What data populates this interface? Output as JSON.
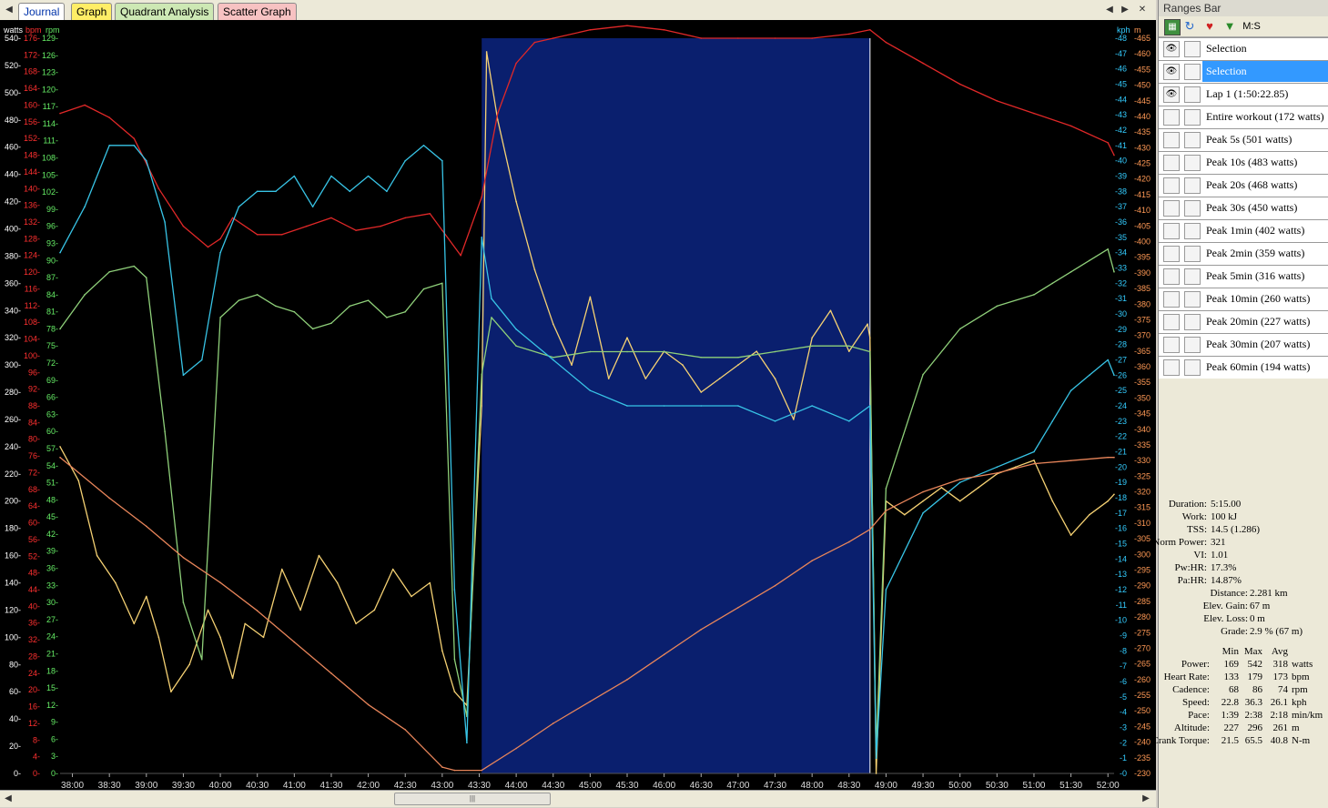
{
  "tabs": [
    {
      "label": "Journal",
      "color": "#ffffff",
      "active": true
    },
    {
      "label": "Graph",
      "color": "#ffee66"
    },
    {
      "label": "Quadrant Analysis",
      "color": "#cde8b4"
    },
    {
      "label": "Scatter Graph",
      "color": "#f7c2c2"
    }
  ],
  "ranges_bar": {
    "title": "Ranges Bar",
    "mode_label": "M:S",
    "items": [
      {
        "label": "Selection",
        "eye": true,
        "selected": false
      },
      {
        "label": "Selection",
        "eye": true,
        "selected": true
      },
      {
        "label": "Lap 1 (1:50:22.85)",
        "eye": true,
        "selected": false
      },
      {
        "label": "Entire workout (172 watts)",
        "eye": false
      },
      {
        "label": "Peak 5s (501 watts)",
        "eye": false
      },
      {
        "label": "Peak 10s (483 watts)",
        "eye": false
      },
      {
        "label": "Peak 20s (468 watts)",
        "eye": false
      },
      {
        "label": "Peak 30s (450 watts)",
        "eye": false
      },
      {
        "label": "Peak 1min (402 watts)",
        "eye": false
      },
      {
        "label": "Peak 2min (359 watts)",
        "eye": false
      },
      {
        "label": "Peak 5min (316 watts)",
        "eye": false
      },
      {
        "label": "Peak 10min (260 watts)",
        "eye": false
      },
      {
        "label": "Peak 20min (227 watts)",
        "eye": false
      },
      {
        "label": "Peak 30min (207 watts)",
        "eye": false
      },
      {
        "label": "Peak 60min (194 watts)",
        "eye": false
      }
    ]
  },
  "summary": [
    {
      "k": "Duration:",
      "v": "5:15.00"
    },
    {
      "k": "Work:",
      "v": "100 kJ"
    },
    {
      "k": "TSS:",
      "v": "14.5 (1.286)"
    },
    {
      "k": "Norm Power:",
      "v": "321"
    },
    {
      "k": "VI:",
      "v": "1.01"
    },
    {
      "k": "Pw:HR:",
      "v": "17.3%"
    },
    {
      "k": "Pa:HR:",
      "v": "14.87%"
    },
    {
      "k": "Distance:",
      "v": "2.281 km"
    },
    {
      "k": "Elev. Gain:",
      "v": "67 m"
    },
    {
      "k": "Elev. Loss:",
      "v": "0 m"
    },
    {
      "k": "Grade:",
      "v": "2.9 % (67 m)"
    }
  ],
  "stats": {
    "header": {
      "min": "Min",
      "max": "Max",
      "avg": "Avg"
    },
    "rows": [
      {
        "k": "Power:",
        "min": "169",
        "max": "542",
        "avg": "318",
        "unit": "watts"
      },
      {
        "k": "Heart Rate:",
        "min": "133",
        "max": "179",
        "avg": "173",
        "unit": "bpm"
      },
      {
        "k": "Cadence:",
        "min": "68",
        "max": "86",
        "avg": "74",
        "unit": "rpm"
      },
      {
        "k": "Speed:",
        "min": "22.8",
        "max": "36.3",
        "avg": "26.1",
        "unit": "kph"
      },
      {
        "k": "Pace:",
        "min": "1:39",
        "max": "2:38",
        "avg": "2:18",
        "unit": "min/km"
      },
      {
        "k": "Altitude:",
        "min": "227",
        "max": "296",
        "avg": "261",
        "unit": "m"
      },
      {
        "k": "Crank Torque:",
        "min": "21.5",
        "max": "65.5",
        "avg": "40.8",
        "unit": "N-m"
      }
    ]
  },
  "chart_data": {
    "type": "line",
    "x_ticks": [
      "38:00",
      "38:30",
      "39:00",
      "39:30",
      "40:00",
      "40:30",
      "41:00",
      "41:30",
      "42:00",
      "42:30",
      "43:00",
      "43:30",
      "44:00",
      "44:30",
      "45:00",
      "45:30",
      "46:00",
      "46:30",
      "47:00",
      "47:30",
      "48:00",
      "48:30",
      "49:00",
      "49:30",
      "50:00",
      "50:30",
      "51:00",
      "51:30",
      "52:00"
    ],
    "x_range": [
      "37:50",
      "52:05"
    ],
    "selection": [
      "43:32",
      "48:47"
    ],
    "axes": {
      "watts": {
        "label": "watts",
        "color": "#ffffff",
        "min": 0,
        "max": 540,
        "step": 20
      },
      "bpm": {
        "label": "bpm",
        "color": "#ff3030",
        "min": 0,
        "max": 176,
        "step": 4
      },
      "rpm": {
        "label": "rpm",
        "color": "#66ee66",
        "min": 0,
        "max": 129,
        "step": 3
      },
      "kph": {
        "label": "kph",
        "color": "#33ccff",
        "min": 0,
        "max": 48,
        "step": 1
      },
      "m": {
        "label": "m",
        "color": "#ff9955",
        "min": 230,
        "max": 465,
        "step": 5
      }
    },
    "series": [
      {
        "name": "Power",
        "axis": "watts",
        "color": "#f5d173",
        "t": [
          "37:50",
          "38:05",
          "38:20",
          "38:35",
          "38:50",
          "39:00",
          "39:10",
          "39:20",
          "39:35",
          "39:50",
          "40:00",
          "40:10",
          "40:20",
          "40:35",
          "40:50",
          "41:05",
          "41:20",
          "41:35",
          "41:50",
          "42:05",
          "42:20",
          "42:35",
          "42:50",
          "43:00",
          "43:10",
          "43:20",
          "43:32",
          "43:36",
          "43:45",
          "44:00",
          "44:15",
          "44:30",
          "44:45",
          "45:00",
          "45:15",
          "45:30",
          "45:45",
          "46:00",
          "46:15",
          "46:30",
          "46:45",
          "47:00",
          "47:15",
          "47:30",
          "47:45",
          "48:00",
          "48:15",
          "48:30",
          "48:45",
          "48:47",
          "48:52",
          "49:00",
          "49:15",
          "49:30",
          "49:45",
          "50:00",
          "50:15",
          "50:30",
          "50:45",
          "51:00",
          "51:15",
          "51:30",
          "51:45",
          "52:00",
          "52:05"
        ],
        "v": [
          240,
          215,
          160,
          140,
          110,
          130,
          100,
          60,
          80,
          120,
          100,
          70,
          110,
          100,
          150,
          120,
          160,
          140,
          110,
          120,
          150,
          130,
          140,
          90,
          60,
          50,
          270,
          530,
          480,
          420,
          370,
          330,
          300,
          350,
          290,
          320,
          290,
          310,
          300,
          280,
          290,
          300,
          310,
          290,
          260,
          320,
          340,
          310,
          330,
          320,
          0,
          200,
          190,
          200,
          210,
          200,
          210,
          220,
          225,
          230,
          200,
          175,
          190,
          200,
          205
        ]
      },
      {
        "name": "Heart Rate",
        "axis": "bpm",
        "color": "#e02828",
        "t": [
          "37:50",
          "38:10",
          "38:30",
          "38:50",
          "39:10",
          "39:30",
          "39:50",
          "40:00",
          "40:10",
          "40:30",
          "40:50",
          "41:10",
          "41:30",
          "41:50",
          "42:10",
          "42:30",
          "42:50",
          "43:00",
          "43:15",
          "43:32",
          "43:45",
          "44:00",
          "44:15",
          "44:30",
          "45:00",
          "45:30",
          "46:00",
          "46:30",
          "47:00",
          "47:30",
          "48:00",
          "48:30",
          "48:47",
          "49:00",
          "49:30",
          "50:00",
          "50:30",
          "51:00",
          "51:30",
          "52:00",
          "52:05"
        ],
        "v": [
          158,
          160,
          157,
          152,
          140,
          131,
          126,
          128,
          133,
          129,
          129,
          131,
          133,
          130,
          131,
          133,
          134,
          130,
          124,
          138,
          158,
          170,
          175,
          176,
          178,
          179,
          178,
          176,
          176,
          176,
          176,
          177,
          178,
          175,
          170,
          165,
          161,
          158,
          155,
          151,
          148
        ]
      },
      {
        "name": "Cadence",
        "axis": "rpm",
        "color": "#8fd07a",
        "t": [
          "37:50",
          "38:10",
          "38:30",
          "38:50",
          "39:00",
          "39:15",
          "39:30",
          "39:45",
          "40:00",
          "40:15",
          "40:30",
          "40:45",
          "41:00",
          "41:15",
          "41:30",
          "41:45",
          "42:00",
          "42:15",
          "42:30",
          "42:45",
          "43:00",
          "43:10",
          "43:20",
          "43:32",
          "43:40",
          "44:00",
          "44:30",
          "45:00",
          "45:30",
          "46:00",
          "46:30",
          "47:00",
          "47:30",
          "48:00",
          "48:30",
          "48:47",
          "48:52",
          "49:00",
          "49:30",
          "50:00",
          "50:30",
          "51:00",
          "51:15",
          "51:30",
          "51:45",
          "52:00",
          "52:05"
        ],
        "v": [
          78,
          84,
          88,
          89,
          87,
          60,
          30,
          20,
          80,
          83,
          84,
          82,
          81,
          78,
          79,
          82,
          83,
          80,
          81,
          85,
          86,
          20,
          10,
          70,
          80,
          75,
          73,
          74,
          74,
          74,
          73,
          73,
          74,
          75,
          75,
          74,
          4,
          50,
          70,
          78,
          82,
          84,
          86,
          88,
          90,
          92,
          88
        ]
      },
      {
        "name": "Speed",
        "axis": "kph",
        "color": "#38c4e6",
        "t": [
          "37:50",
          "38:10",
          "38:30",
          "38:50",
          "39:00",
          "39:15",
          "39:30",
          "39:45",
          "40:00",
          "40:15",
          "40:30",
          "40:45",
          "41:00",
          "41:15",
          "41:30",
          "41:45",
          "42:00",
          "42:15",
          "42:30",
          "42:45",
          "43:00",
          "43:10",
          "43:20",
          "43:32",
          "43:40",
          "44:00",
          "44:30",
          "45:00",
          "45:30",
          "46:00",
          "46:30",
          "47:00",
          "47:30",
          "48:00",
          "48:30",
          "48:47",
          "48:52",
          "49:00",
          "49:30",
          "50:00",
          "50:30",
          "51:00",
          "51:15",
          "51:30",
          "51:45",
          "52:00",
          "52:05"
        ],
        "v": [
          34,
          37,
          41,
          41,
          40,
          36,
          26,
          27,
          34,
          37,
          38,
          38,
          39,
          37,
          39,
          38,
          39,
          38,
          40,
          41,
          40,
          12,
          2,
          35,
          31,
          29,
          27,
          25,
          24,
          24,
          24,
          24,
          23,
          24,
          23,
          24,
          1,
          12,
          17,
          19,
          20,
          21,
          23,
          25,
          26,
          27,
          26
        ]
      },
      {
        "name": "Altitude",
        "axis": "m",
        "color": "#e8855a",
        "t": [
          "37:50",
          "38:30",
          "39:00",
          "39:30",
          "40:00",
          "40:30",
          "41:00",
          "41:30",
          "42:00",
          "42:30",
          "43:00",
          "43:10",
          "43:32",
          "44:00",
          "44:30",
          "45:00",
          "45:30",
          "46:00",
          "46:30",
          "47:00",
          "47:30",
          "48:00",
          "48:30",
          "48:47",
          "49:00",
          "49:30",
          "50:00",
          "50:30",
          "51:00",
          "51:30",
          "52:00",
          "52:05"
        ],
        "v": [
          331,
          318,
          309,
          299,
          291,
          282,
          272,
          262,
          252,
          244,
          232,
          231,
          231,
          238,
          246,
          253,
          260,
          268,
          276,
          283,
          290,
          298,
          304,
          308,
          314,
          320,
          324,
          326,
          329,
          330,
          331,
          331
        ]
      }
    ]
  }
}
